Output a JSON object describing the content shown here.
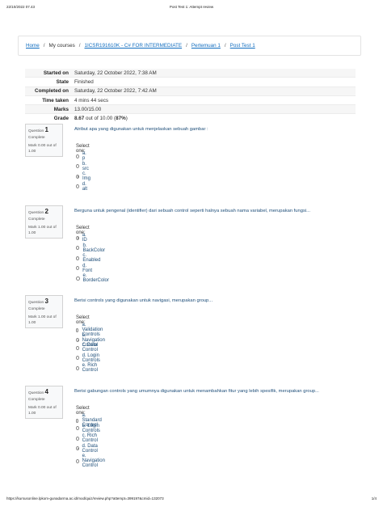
{
  "print": {
    "date": "22/10/2022 07.43",
    "title": "Post Test 1: Attempt review",
    "url": "https://kursusonline.lpkom-gunadarma.ac.id/mod/quiz/review.php?attempt=399197&cmid=132073",
    "page": "1/4"
  },
  "breadcrumb": [
    {
      "label": "Home",
      "link": true
    },
    {
      "label": "My courses",
      "link": false
    },
    {
      "label": "1ICSR191610K - C# FOR INTERMEDIATE",
      "link": true
    },
    {
      "label": "Pertemuan 1",
      "link": true
    },
    {
      "label": "Post Test 1",
      "link": true
    }
  ],
  "summary": [
    {
      "key": "Started on",
      "value": "Saturday, 22 October 2022, 7:38 AM",
      "bold_value": ""
    },
    {
      "key": "State",
      "value": "Finished",
      "bold_value": ""
    },
    {
      "key": "Completed on",
      "value": "Saturday, 22 October 2022, 7:42 AM",
      "bold_value": ""
    },
    {
      "key": "Time taken",
      "value": "4 mins 44 secs",
      "bold_value": ""
    },
    {
      "key": "Marks",
      "value": "13.00/15.00",
      "bold_value": ""
    },
    {
      "key": "Grade",
      "value": " out of 10.00 (",
      "bold_value": "8.67",
      "bold_tail": "87%",
      "tail": ")"
    }
  ],
  "select_label": "Select one:",
  "questions": [
    {
      "label": "Question",
      "number": "1",
      "state": "Complete",
      "mark": "Mark 0.00 out of 1.00",
      "text": "Atribut apa yang digunakan untuk menjelaskan sebuah gambar :",
      "options": [
        "a. p",
        "b. src",
        "c. Img",
        "d. alt"
      ],
      "selected": 2
    },
    {
      "label": "Question",
      "number": "2",
      "state": "Complete",
      "mark": "Mark 1.00 out of 1.00",
      "text": "Berguna untuk pengenal (identifier) dari sebuah control seperti halnya sebuah nama variabel, merupakan fungsi...",
      "options": [
        "a. ID",
        "b. BackColor",
        "c. Enabled",
        "d. Font",
        "e. BorderColor"
      ],
      "selected": 0
    },
    {
      "label": "Question",
      "number": "3",
      "state": "Complete",
      "mark": "Mark 1.00 out of 1.00",
      "text": "Berisi controls yang digunakan untuk navigasi, merupakan group...",
      "options": [
        "a. Validation Controls",
        "b. Navigation Control",
        "c. Data Control",
        "d. Login Controls",
        "e. Rich Control"
      ],
      "selected": 1
    },
    {
      "label": "Question",
      "number": "4",
      "state": "Complete",
      "mark": "Mark 0.00 out of 1.00",
      "text": "Berisi gabungan controls yang umumnya digunakan untuk menambahkan fitur yang lebih spesifik, merupakan group...",
      "options": [
        "a. Standard Control",
        "b. Login Controls",
        "c. Rich Control",
        "d. Data Control",
        "e. Navigation Control"
      ],
      "selected": 3
    }
  ]
}
